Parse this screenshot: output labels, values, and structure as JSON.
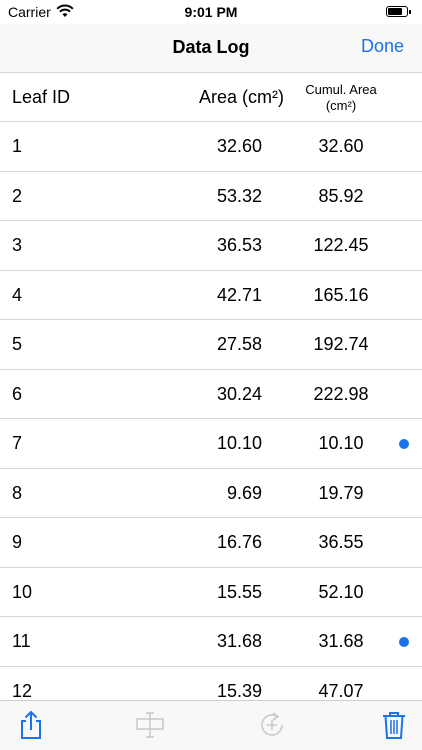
{
  "status": {
    "carrier": "Carrier",
    "time": "9:01 PM",
    "battery_level": 0.75
  },
  "nav": {
    "title": "Data Log",
    "done_label": "Done"
  },
  "columns": {
    "leaf_id": "Leaf ID",
    "area": "Area (cm²)",
    "cumul_line1": "Cumul. Area",
    "cumul_line2": "(cm²)"
  },
  "rows": [
    {
      "id": "1",
      "area": "32.60",
      "cumul": "32.60",
      "marked": false
    },
    {
      "id": "2",
      "area": "53.32",
      "cumul": "85.92",
      "marked": false
    },
    {
      "id": "3",
      "area": "36.53",
      "cumul": "122.45",
      "marked": false
    },
    {
      "id": "4",
      "area": "42.71",
      "cumul": "165.16",
      "marked": false
    },
    {
      "id": "5",
      "area": "27.58",
      "cumul": "192.74",
      "marked": false
    },
    {
      "id": "6",
      "area": "30.24",
      "cumul": "222.98",
      "marked": false
    },
    {
      "id": "7",
      "area": "10.10",
      "cumul": "10.10",
      "marked": true
    },
    {
      "id": "8",
      "area": "9.69",
      "cumul": "19.79",
      "marked": false
    },
    {
      "id": "9",
      "area": "16.76",
      "cumul": "36.55",
      "marked": false
    },
    {
      "id": "10",
      "area": "15.55",
      "cumul": "52.10",
      "marked": false
    },
    {
      "id": "11",
      "area": "31.68",
      "cumul": "31.68",
      "marked": true
    },
    {
      "id": "12",
      "area": "15.39",
      "cumul": "47.07",
      "marked": false
    }
  ],
  "toolbar": {
    "share_icon": "share-icon",
    "split_icon": "text-cursor-split-icon",
    "add_icon": "add-refresh-icon",
    "trash_icon": "trash-icon"
  },
  "colors": {
    "accent": "#1a73e8",
    "disabled": "#c7c7cc"
  }
}
